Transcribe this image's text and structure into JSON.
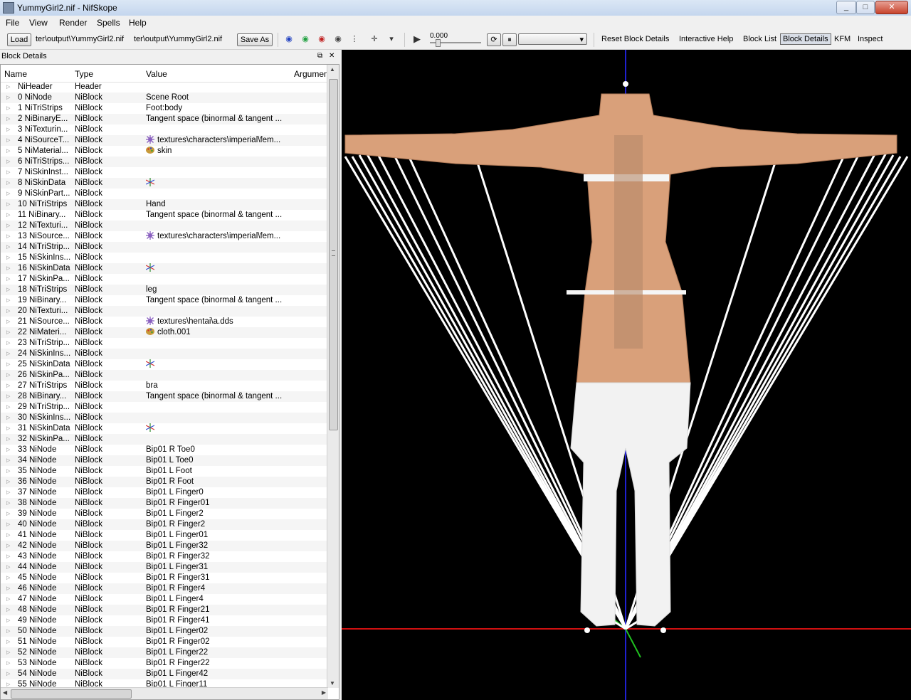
{
  "window": {
    "title": "YummyGirl2.nif - NifSkope",
    "min": "_",
    "max": "□",
    "close": "✕"
  },
  "menu": [
    "File",
    "View",
    "Render",
    "Spells",
    "Help"
  ],
  "toolbar": {
    "load": "Load",
    "path1": "ter\\output\\YummyGirl2.nif",
    "path2": "ter\\output\\YummyGirl2.nif",
    "save_as": "Save As",
    "time_value": "0.000",
    "links": [
      "Reset Block Details",
      "Interactive Help",
      "Block List",
      "Block Details",
      "KFM",
      "Inspect"
    ],
    "active_link": "Block Details"
  },
  "dock": {
    "title": "Block Details",
    "float_icon": "⧉",
    "close_icon": "✕"
  },
  "table": {
    "headers": [
      "Name",
      "Type",
      "Value",
      "Argumen"
    ],
    "rows": [
      [
        "NiHeader",
        "Header",
        "",
        ""
      ],
      [
        "0 NiNode",
        "NiBlock",
        "Scene Root",
        ""
      ],
      [
        "1 NiTriStrips",
        "NiBlock",
        "Foot:body",
        ""
      ],
      [
        "2 NiBinaryE...",
        "NiBlock",
        "Tangent space (binormal & tangent ...",
        ""
      ],
      [
        "3 NiTexturin...",
        "NiBlock",
        "",
        ""
      ],
      [
        "4 NiSourceT...",
        "NiBlock",
        "textures\\characters\\imperial\\fem...",
        "texture-icon"
      ],
      [
        "5 NiMaterial...",
        "NiBlock",
        "skin",
        "palette-icon"
      ],
      [
        "6 NiTriStrips...",
        "NiBlock",
        "",
        ""
      ],
      [
        "7 NiSkinInst...",
        "NiBlock",
        "",
        ""
      ],
      [
        "8 NiSkinData",
        "NiBlock",
        "",
        "axes-icon"
      ],
      [
        "9 NiSkinPart...",
        "NiBlock",
        "",
        ""
      ],
      [
        "10 NiTriStrips",
        "NiBlock",
        "Hand",
        ""
      ],
      [
        "11 NiBinary...",
        "NiBlock",
        "Tangent space (binormal & tangent ...",
        ""
      ],
      [
        "12 NiTexturi...",
        "NiBlock",
        "",
        ""
      ],
      [
        "13 NiSource...",
        "NiBlock",
        "textures\\characters\\imperial\\fem...",
        "texture-icon"
      ],
      [
        "14 NiTriStrip...",
        "NiBlock",
        "",
        ""
      ],
      [
        "15 NiSkinIns...",
        "NiBlock",
        "",
        ""
      ],
      [
        "16 NiSkinData",
        "NiBlock",
        "",
        "axes-icon"
      ],
      [
        "17 NiSkinPa...",
        "NiBlock",
        "",
        ""
      ],
      [
        "18 NiTriStrips",
        "NiBlock",
        "leg",
        ""
      ],
      [
        "19 NiBinary...",
        "NiBlock",
        "Tangent space (binormal & tangent ...",
        ""
      ],
      [
        "20 NiTexturi...",
        "NiBlock",
        "",
        ""
      ],
      [
        "21 NiSource...",
        "NiBlock",
        "textures\\hentai\\a.dds",
        "texture-icon"
      ],
      [
        "22 NiMateri...",
        "NiBlock",
        "cloth.001",
        "palette-icon"
      ],
      [
        "23 NiTriStrip...",
        "NiBlock",
        "",
        ""
      ],
      [
        "24 NiSkinIns...",
        "NiBlock",
        "",
        ""
      ],
      [
        "25 NiSkinData",
        "NiBlock",
        "",
        "axes-icon"
      ],
      [
        "26 NiSkinPa...",
        "NiBlock",
        "",
        ""
      ],
      [
        "27 NiTriStrips",
        "NiBlock",
        "bra",
        ""
      ],
      [
        "28 NiBinary...",
        "NiBlock",
        "Tangent space (binormal & tangent ...",
        ""
      ],
      [
        "29 NiTriStrip...",
        "NiBlock",
        "",
        ""
      ],
      [
        "30 NiSkinIns...",
        "NiBlock",
        "",
        ""
      ],
      [
        "31 NiSkinData",
        "NiBlock",
        "",
        "axes-icon"
      ],
      [
        "32 NiSkinPa...",
        "NiBlock",
        "",
        ""
      ],
      [
        "33 NiNode",
        "NiBlock",
        "Bip01 R Toe0",
        ""
      ],
      [
        "34 NiNode",
        "NiBlock",
        "Bip01 L Toe0",
        ""
      ],
      [
        "35 NiNode",
        "NiBlock",
        "Bip01 L Foot",
        ""
      ],
      [
        "36 NiNode",
        "NiBlock",
        "Bip01 R Foot",
        ""
      ],
      [
        "37 NiNode",
        "NiBlock",
        "Bip01 L Finger0",
        ""
      ],
      [
        "38 NiNode",
        "NiBlock",
        "Bip01 R Finger01",
        ""
      ],
      [
        "39 NiNode",
        "NiBlock",
        "Bip01 L Finger2",
        ""
      ],
      [
        "40 NiNode",
        "NiBlock",
        "Bip01 R Finger2",
        ""
      ],
      [
        "41 NiNode",
        "NiBlock",
        "Bip01 L Finger01",
        ""
      ],
      [
        "42 NiNode",
        "NiBlock",
        "Bip01 L Finger32",
        ""
      ],
      [
        "43 NiNode",
        "NiBlock",
        "Bip01 R Finger32",
        ""
      ],
      [
        "44 NiNode",
        "NiBlock",
        "Bip01 L Finger31",
        ""
      ],
      [
        "45 NiNode",
        "NiBlock",
        "Bip01 R Finger31",
        ""
      ],
      [
        "46 NiNode",
        "NiBlock",
        "Bip01 R Finger4",
        ""
      ],
      [
        "47 NiNode",
        "NiBlock",
        "Bip01 L Finger4",
        ""
      ],
      [
        "48 NiNode",
        "NiBlock",
        "Bip01 R Finger21",
        ""
      ],
      [
        "49 NiNode",
        "NiBlock",
        "Bip01 R Finger41",
        ""
      ],
      [
        "50 NiNode",
        "NiBlock",
        "Bip01 L Finger02",
        ""
      ],
      [
        "51 NiNode",
        "NiBlock",
        "Bip01 R Finger02",
        ""
      ],
      [
        "52 NiNode",
        "NiBlock",
        "Bip01 L Finger22",
        ""
      ],
      [
        "53 NiNode",
        "NiBlock",
        "Bip01 R Finger22",
        ""
      ],
      [
        "54 NiNode",
        "NiBlock",
        "Bip01 L Finger42",
        ""
      ],
      [
        "55 NiNode",
        "NiBlock",
        "Bip01 L Finger11",
        ""
      ]
    ]
  },
  "colors": {
    "viewport_bg": "#000000",
    "skin": "#d9a07a",
    "axis_red": "#d01010",
    "axis_blue": "#2020d0",
    "axis_green": "#20c020"
  }
}
